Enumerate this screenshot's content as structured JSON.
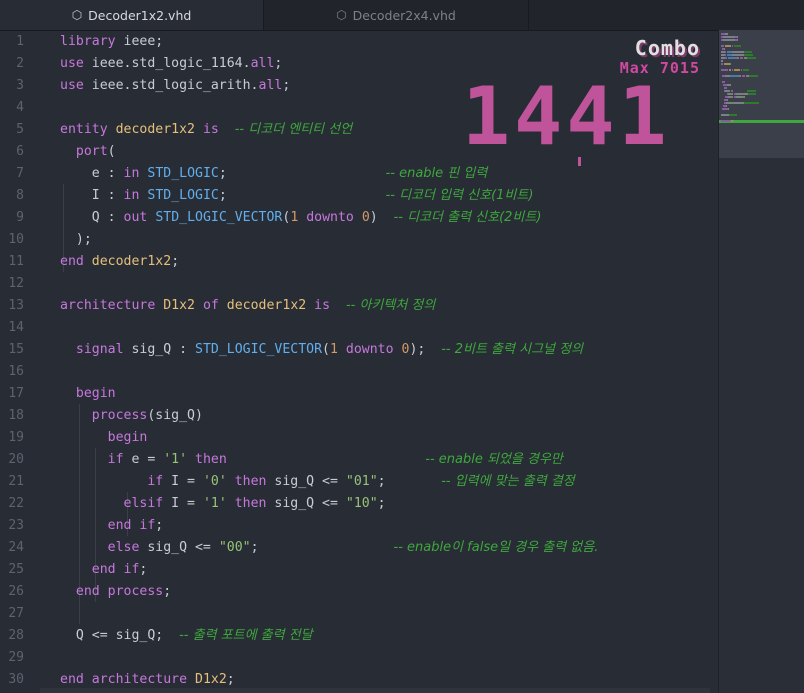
{
  "tabs": [
    {
      "label": "Decoder1x2.vhd",
      "icon": "box-icon",
      "active": true
    },
    {
      "label": "Decoder2x4.vhd",
      "icon": "box-icon",
      "active": false
    }
  ],
  "combo": {
    "label": "Combo",
    "max": "Max 7015",
    "count": "1441"
  },
  "line_numbers": [
    "1",
    "2",
    "3",
    "4",
    "5",
    "6",
    "7",
    "8",
    "9",
    "10",
    "11",
    "12",
    "13",
    "14",
    "15",
    "16",
    "17",
    "18",
    "19",
    "20",
    "21",
    "22",
    "23",
    "24",
    "25",
    "26",
    "27",
    "28",
    "29",
    "30"
  ],
  "code_lines": [
    [
      [
        "kw",
        "library"
      ],
      [
        "pl",
        " ieee;"
      ]
    ],
    [
      [
        "kw",
        "use"
      ],
      [
        "pl",
        " ieee.std_logic_1164."
      ],
      [
        "kw",
        "all"
      ],
      [
        "pl",
        ";"
      ]
    ],
    [
      [
        "kw",
        "use"
      ],
      [
        "pl",
        " ieee.std_logic_arith."
      ],
      [
        "kw",
        "all"
      ],
      [
        "pl",
        ";"
      ]
    ],
    [],
    [
      [
        "kw",
        "entity"
      ],
      [
        "pl",
        " "
      ],
      [
        "id",
        "decoder1x2"
      ],
      [
        "pl",
        " "
      ],
      [
        "kw",
        "is"
      ],
      [
        "pl",
        "  "
      ],
      [
        "cm",
        "-- 디코더 엔티티 선언"
      ]
    ],
    [
      [
        "pl",
        "  "
      ],
      [
        "kw",
        "port"
      ],
      [
        "pl",
        "("
      ]
    ],
    [
      [
        "pl",
        "    e : "
      ],
      [
        "kw",
        "in"
      ],
      [
        "pl",
        " "
      ],
      [
        "ty",
        "STD_LOGIC"
      ],
      [
        "pl",
        ";                    "
      ],
      [
        "cm",
        "-- enable 핀 입력"
      ]
    ],
    [
      [
        "pl",
        "    I : "
      ],
      [
        "kw",
        "in"
      ],
      [
        "pl",
        " "
      ],
      [
        "ty",
        "STD_LOGIC"
      ],
      [
        "pl",
        ";                    "
      ],
      [
        "cm",
        "-- 디코더 입력 신호(1비트)"
      ]
    ],
    [
      [
        "pl",
        "    Q : "
      ],
      [
        "kw",
        "out"
      ],
      [
        "pl",
        " "
      ],
      [
        "ty",
        "STD_LOGIC_VECTOR"
      ],
      [
        "pl",
        "("
      ],
      [
        "num",
        "1"
      ],
      [
        "pl",
        " "
      ],
      [
        "kw",
        "downto"
      ],
      [
        "pl",
        " "
      ],
      [
        "num",
        "0"
      ],
      [
        "pl",
        ")  "
      ],
      [
        "cm",
        "-- 디코더 출력 신호(2비트)"
      ]
    ],
    [
      [
        "pl",
        "  );"
      ]
    ],
    [
      [
        "kw",
        "end"
      ],
      [
        "pl",
        " "
      ],
      [
        "id",
        "decoder1x2"
      ],
      [
        "pl",
        ";"
      ]
    ],
    [],
    [
      [
        "kw",
        "architecture"
      ],
      [
        "pl",
        " "
      ],
      [
        "id",
        "D1x2"
      ],
      [
        "pl",
        " "
      ],
      [
        "kw",
        "of"
      ],
      [
        "pl",
        " "
      ],
      [
        "id",
        "decoder1x2"
      ],
      [
        "pl",
        " "
      ],
      [
        "kw",
        "is"
      ],
      [
        "pl",
        "  "
      ],
      [
        "cm",
        "-- 아키텍처 정의"
      ]
    ],
    [],
    [
      [
        "pl",
        "  "
      ],
      [
        "kw",
        "signal"
      ],
      [
        "pl",
        " sig_Q : "
      ],
      [
        "ty",
        "STD_LOGIC_VECTOR"
      ],
      [
        "pl",
        "("
      ],
      [
        "num",
        "1"
      ],
      [
        "pl",
        " "
      ],
      [
        "kw",
        "downto"
      ],
      [
        "pl",
        " "
      ],
      [
        "num",
        "0"
      ],
      [
        "pl",
        ");  "
      ],
      [
        "cm",
        "-- 2비트 출력 시그널 정의"
      ]
    ],
    [],
    [
      [
        "pl",
        "  "
      ],
      [
        "kw",
        "begin"
      ]
    ],
    [
      [
        "pl",
        "    "
      ],
      [
        "kw",
        "process"
      ],
      [
        "pl",
        "(sig_Q)"
      ]
    ],
    [
      [
        "pl",
        "      "
      ],
      [
        "kw",
        "begin"
      ]
    ],
    [
      [
        "pl",
        "      "
      ],
      [
        "kw",
        "if"
      ],
      [
        "pl",
        " e = "
      ],
      [
        "str",
        "'1'"
      ],
      [
        "pl",
        " "
      ],
      [
        "kw",
        "then"
      ],
      [
        "pl",
        "                         "
      ],
      [
        "cm",
        "-- enable 되었을 경우만"
      ]
    ],
    [
      [
        "pl",
        "           "
      ],
      [
        "kw",
        "if"
      ],
      [
        "pl",
        " I = "
      ],
      [
        "str",
        "'0'"
      ],
      [
        "pl",
        " "
      ],
      [
        "kw",
        "then"
      ],
      [
        "pl",
        " sig_Q <= "
      ],
      [
        "str",
        "\"01\""
      ],
      [
        "pl",
        ";       "
      ],
      [
        "cm",
        "-- 입력에 맞는 출력 결정"
      ]
    ],
    [
      [
        "pl",
        "        "
      ],
      [
        "kw",
        "elsif"
      ],
      [
        "pl",
        " I = "
      ],
      [
        "str",
        "'1'"
      ],
      [
        "pl",
        " "
      ],
      [
        "kw",
        "then"
      ],
      [
        "pl",
        " sig_Q <= "
      ],
      [
        "str",
        "\"10\""
      ],
      [
        "pl",
        ";"
      ]
    ],
    [
      [
        "pl",
        "      "
      ],
      [
        "kw",
        "end if"
      ],
      [
        "pl",
        ";"
      ]
    ],
    [
      [
        "pl",
        "      "
      ],
      [
        "kw",
        "else"
      ],
      [
        "pl",
        " sig_Q <= "
      ],
      [
        "str",
        "\"00\""
      ],
      [
        "pl",
        ";                 "
      ],
      [
        "cm",
        "-- enable이 false일 경우 출력 없음."
      ]
    ],
    [
      [
        "pl",
        "    "
      ],
      [
        "kw",
        "end if"
      ],
      [
        "pl",
        ";"
      ]
    ],
    [
      [
        "pl",
        "  "
      ],
      [
        "kw",
        "end process"
      ],
      [
        "pl",
        ";"
      ]
    ],
    [],
    [
      [
        "pl",
        "  Q <= sig_Q;  "
      ],
      [
        "cm",
        "-- 출력 포트에 출력 전달"
      ]
    ],
    [],
    [
      [
        "kw",
        "end architecture"
      ],
      [
        "pl",
        " "
      ],
      [
        "id",
        "D1x2"
      ],
      [
        "pl",
        ";"
      ]
    ]
  ]
}
